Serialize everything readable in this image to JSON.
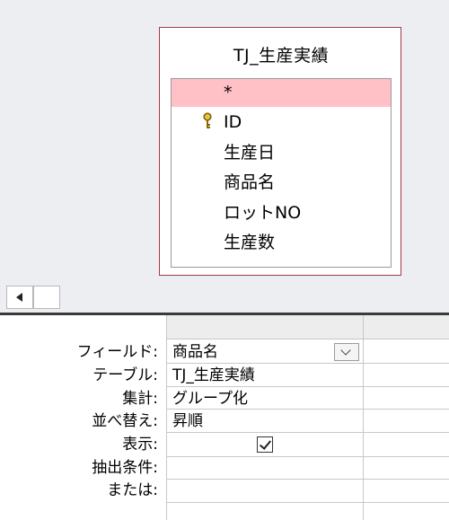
{
  "table_field_list": {
    "title": "TJ_生産実績",
    "fields": [
      {
        "label": "*",
        "selected": true,
        "primary_key": false
      },
      {
        "label": "ID",
        "selected": false,
        "primary_key": true
      },
      {
        "label": "生産日",
        "selected": false,
        "primary_key": false
      },
      {
        "label": "商品名",
        "selected": false,
        "primary_key": false
      },
      {
        "label": "ロットNO",
        "selected": false,
        "primary_key": false
      },
      {
        "label": "生産数",
        "selected": false,
        "primary_key": false
      }
    ]
  },
  "design_grid": {
    "row_labels": {
      "field": "フィールド:",
      "table": "テーブル:",
      "total": "集計:",
      "sort": "並べ替え:",
      "show": "表示:",
      "criteria": "抽出条件:",
      "or": "または:"
    },
    "column1": {
      "field": "商品名",
      "table": "TJ_生産実績",
      "total": "グループ化",
      "sort": "昇順",
      "show": true,
      "criteria": "",
      "or": ""
    }
  },
  "colors": {
    "selection_highlight": "#ffc0c6",
    "field_list_border": "#a33a48",
    "design_background": "#eceef1"
  }
}
